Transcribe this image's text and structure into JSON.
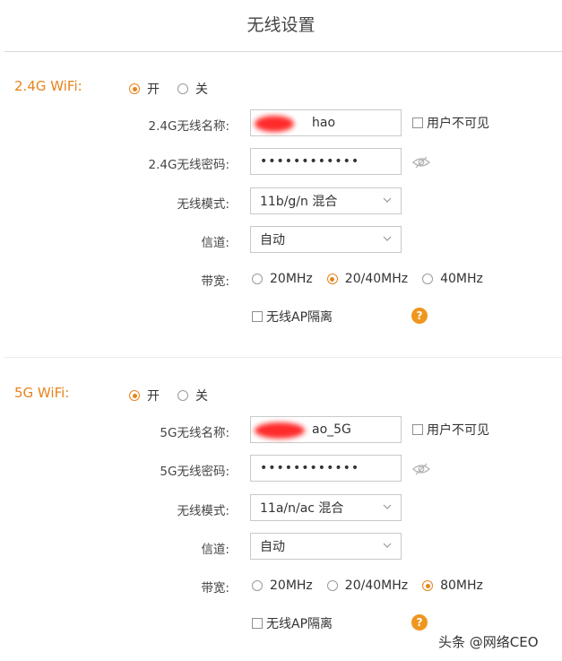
{
  "page_title": "无线设置",
  "colors": {
    "accent": "#e8831c",
    "help": "#f0961f",
    "redaction": "#ff1a1a"
  },
  "wifi24": {
    "label": "2.4G WiFi:",
    "power": {
      "on": "开",
      "off": "关",
      "selected": "开"
    },
    "ssid_label": "2.4G无线名称:",
    "ssid_value": "hao",
    "hidden_label": "用户不可见",
    "password_label": "2.4G无线密码:",
    "password_value": "••••••••••••",
    "mode_label": "无线模式:",
    "mode_value": "11b/g/n 混合",
    "channel_label": "信道:",
    "channel_value": "自动",
    "bandwidth_label": "带宽:",
    "bandwidth_options": [
      "20MHz",
      "20/40MHz",
      "40MHz"
    ],
    "bandwidth_selected": "20/40MHz",
    "ap_isolation_label": "无线AP隔离",
    "help_glyph": "?"
  },
  "wifi5": {
    "label": "5G WiFi:",
    "power": {
      "on": "开",
      "off": "关",
      "selected": "开"
    },
    "ssid_label": "5G无线名称:",
    "ssid_value": "ao_5G",
    "hidden_label": "用户不可见",
    "password_label": "5G无线密码:",
    "password_value": "••••••••••••",
    "mode_label": "无线模式:",
    "mode_value": "11a/n/ac 混合",
    "channel_label": "信道:",
    "channel_value": "自动",
    "bandwidth_label": "带宽:",
    "bandwidth_options": [
      "20MHz",
      "20/40MHz",
      "80MHz"
    ],
    "bandwidth_selected": "80MHz",
    "ap_isolation_label": "无线AP隔离",
    "help_glyph": "?"
  },
  "icons": {
    "password_toggle": "eye-hidden-icon",
    "select": "chevron-down-icon",
    "help": "help-icon"
  },
  "watermark": "头条 @网络CEO"
}
